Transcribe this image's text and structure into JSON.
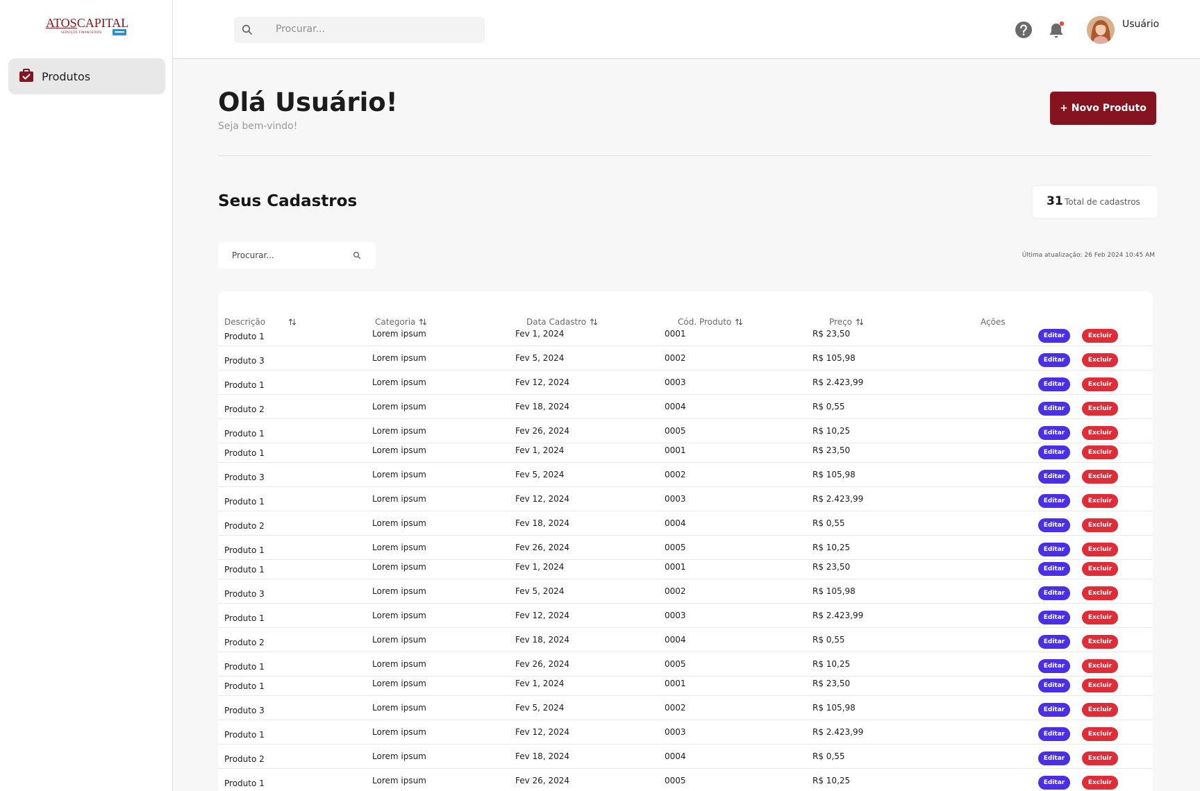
{
  "brand": {
    "name_part1": "ATOS",
    "name_part2": "CAPITAL",
    "tagline": "SERVIÇOS FINANCEIROS"
  },
  "sidebar": {
    "items": [
      {
        "label": "Produtos",
        "icon": "briefcase-check-icon",
        "active": true
      }
    ]
  },
  "topbar": {
    "search_placeholder": "Procurar...",
    "user_name": "Usuário",
    "notification_dot_color": "#e74c3c"
  },
  "main": {
    "greeting": "Olá Usuário!",
    "subgreeting": "Seja bem-vindo!",
    "new_button": "+ Novo Produto",
    "section_title": "Seus Cadastros",
    "total_count": "31",
    "total_label": "Total de cadastros",
    "table_search_placeholder": "Procurar...",
    "last_update": "Última atualização: 26 Feb 2024 10:45 AM"
  },
  "colors": {
    "brand": "#861320",
    "edit": "#4a2ee8",
    "delete": "#e02c36"
  },
  "table": {
    "columns": [
      "Descrição",
      "Categoria",
      "Data Cadastro",
      "Cód. Produto",
      "Preço",
      "Ações"
    ],
    "edit_label": "Editar",
    "delete_label": "Excluir",
    "rows": [
      {
        "desc": "Produto 1",
        "cat": "Lorem ipsum",
        "date": "Fev 1, 2024",
        "code": "0001",
        "price": "R$ 23,50"
      },
      {
        "desc": "Produto 3",
        "cat": "Lorem ipsum",
        "date": "Fev 5, 2024",
        "code": "0002",
        "price": "R$ 105,98"
      },
      {
        "desc": "Produto 1",
        "cat": "Lorem ipsum",
        "date": "Fev 12, 2024",
        "code": "0003",
        "price": "R$ 2.423,99"
      },
      {
        "desc": "Produto 2",
        "cat": "Lorem ipsum",
        "date": "Fev 18, 2024",
        "code": "0004",
        "price": "R$ 0,55"
      },
      {
        "desc": "Produto 1",
        "cat": "Lorem ipsum",
        "date": "Fev 26, 2024",
        "code": "0005",
        "price": "R$ 10,25"
      },
      {
        "desc": "Produto 1",
        "cat": "Lorem ipsum",
        "date": "Fev 1, 2024",
        "code": "0001",
        "price": "R$ 23,50"
      },
      {
        "desc": "Produto 3",
        "cat": "Lorem ipsum",
        "date": "Fev 5, 2024",
        "code": "0002",
        "price": "R$ 105,98"
      },
      {
        "desc": "Produto 1",
        "cat": "Lorem ipsum",
        "date": "Fev 12, 2024",
        "code": "0003",
        "price": "R$ 2.423,99"
      },
      {
        "desc": "Produto 2",
        "cat": "Lorem ipsum",
        "date": "Fev 18, 2024",
        "code": "0004",
        "price": "R$ 0,55"
      },
      {
        "desc": "Produto 1",
        "cat": "Lorem ipsum",
        "date": "Fev 26, 2024",
        "code": "0005",
        "price": "R$ 10,25"
      },
      {
        "desc": "Produto 1",
        "cat": "Lorem ipsum",
        "date": "Fev 1, 2024",
        "code": "0001",
        "price": "R$ 23,50"
      },
      {
        "desc": "Produto 3",
        "cat": "Lorem ipsum",
        "date": "Fev 5, 2024",
        "code": "0002",
        "price": "R$ 105,98"
      },
      {
        "desc": "Produto 1",
        "cat": "Lorem ipsum",
        "date": "Fev 12, 2024",
        "code": "0003",
        "price": "R$ 2.423,99"
      },
      {
        "desc": "Produto 2",
        "cat": "Lorem ipsum",
        "date": "Fev 18, 2024",
        "code": "0004",
        "price": "R$ 0,55"
      },
      {
        "desc": "Produto 1",
        "cat": "Lorem ipsum",
        "date": "Fev 26, 2024",
        "code": "0005",
        "price": "R$ 10,25"
      },
      {
        "desc": "Produto 1",
        "cat": "Lorem ipsum",
        "date": "Fev 1, 2024",
        "code": "0001",
        "price": "R$ 23,50"
      },
      {
        "desc": "Produto 3",
        "cat": "Lorem ipsum",
        "date": "Fev 5, 2024",
        "code": "0002",
        "price": "R$ 105,98"
      },
      {
        "desc": "Produto 1",
        "cat": "Lorem ipsum",
        "date": "Fev 12, 2024",
        "code": "0003",
        "price": "R$ 2.423,99"
      },
      {
        "desc": "Produto 2",
        "cat": "Lorem ipsum",
        "date": "Fev 18, 2024",
        "code": "0004",
        "price": "R$ 0,55"
      },
      {
        "desc": "Produto 1",
        "cat": "Lorem ipsum",
        "date": "Fev 26, 2024",
        "code": "0005",
        "price": "R$ 10,25"
      }
    ]
  }
}
